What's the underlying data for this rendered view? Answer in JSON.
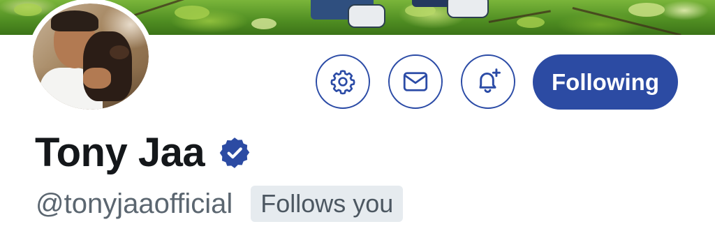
{
  "profile": {
    "display_name": "Tony Jaa",
    "handle": "@tonyjaaofficial",
    "follows_you_label": "Follows you",
    "verified_icon": "verified-badge-icon"
  },
  "actions": {
    "settings_icon": "gear-icon",
    "message_icon": "envelope-icon",
    "notify_icon": "bell-plus-icon",
    "follow_label": "Following"
  },
  "colors": {
    "accent": "#2c4ba3",
    "name_text": "#14171a",
    "secondary_text": "#5b6670",
    "badge_bg": "#e6ebef"
  }
}
